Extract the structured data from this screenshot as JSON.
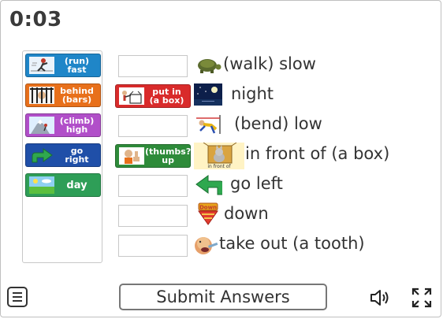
{
  "timer": "0:03",
  "bank": [
    {
      "text": "(run)\nfast",
      "color": "#1f86c8",
      "icon": "running-person-icon"
    },
    {
      "text": "behind\n(bars)",
      "color": "#e8701b",
      "icon": "jail-bars-icon"
    },
    {
      "text": "(climb)\nhigh",
      "color": "#b14fc9",
      "icon": "mountain-climb-icon"
    },
    {
      "text": "go\nright",
      "color": "#1f4fa8",
      "icon": "arrow-right-icon"
    },
    {
      "text": "day",
      "color": "#2e9e57",
      "icon": "sunny-field-icon"
    }
  ],
  "rows": [
    {
      "filled": null,
      "icon": "turtle-icon",
      "label": "(walk) slow"
    },
    {
      "filled": {
        "text": "put in\n(a box)",
        "color": "#d92b2b",
        "icon": "box-icon"
      },
      "icon": "night-sky-icon",
      "label": "night"
    },
    {
      "filled": null,
      "icon": "bending-person-icon",
      "label": "(bend) low"
    },
    {
      "filled": {
        "text": "(thumbs?\nup",
        "color": "#2e8b3a",
        "icon": "thumbs-up-icon"
      },
      "icon": "cat-in-front-of-box-icon",
      "label": "in front of (a box)",
      "icon_caption": "in front of"
    },
    {
      "filled": null,
      "icon": "arrow-left-icon",
      "label": "go left"
    },
    {
      "filled": null,
      "icon": "down-arrow-icon",
      "label": "down",
      "icon_caption": "Down"
    },
    {
      "filled": null,
      "icon": "tooth-extraction-icon",
      "label": "take out (a tooth)"
    }
  ],
  "submit_label": "Submit Answers",
  "menu_icon": "hamburger-menu-icon",
  "sound_icon": "speaker-icon",
  "fullscreen_icon": "fullscreen-icon"
}
